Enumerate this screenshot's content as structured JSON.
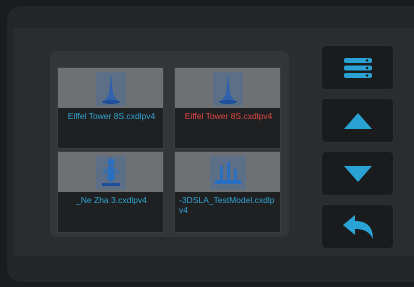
{
  "files": [
    {
      "name": "Eiffel Tower 8S.cxdlpv4",
      "selected": false,
      "thumbnail_icon": "tower-model-icon"
    },
    {
      "name": "Eiffel Tower 8S.cxdlpv4",
      "selected": true,
      "thumbnail_icon": "tower-model-icon"
    },
    {
      "name": "_Ne Zha 3.cxdlpv4",
      "selected": false,
      "thumbnail_icon": "figure-model-icon"
    },
    {
      "name": "-3DSLA_TestModel.cxdlpv4",
      "selected": false,
      "thumbnail_icon": "test-model-icon"
    }
  ],
  "sidebar": {
    "buttons": [
      {
        "icon": "menu-list-icon"
      },
      {
        "icon": "arrow-up-icon"
      },
      {
        "icon": "arrow-down-icon"
      },
      {
        "icon": "back-arrow-icon"
      }
    ]
  },
  "colors": {
    "accent": "#31a4d3",
    "selected_text": "#e04646",
    "icon": "#2aa3d4"
  }
}
